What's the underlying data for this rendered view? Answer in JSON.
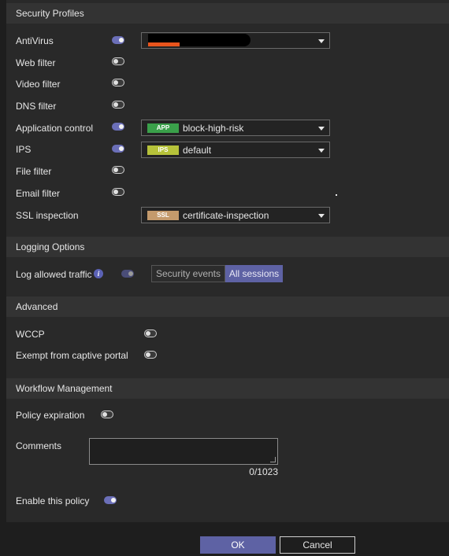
{
  "security_profiles": {
    "header": "Security Profiles",
    "rows": [
      {
        "label": "AntiVirus",
        "enabled": true,
        "badge": "",
        "value": "",
        "redacted": true
      },
      {
        "label": "Web filter",
        "enabled": false
      },
      {
        "label": "Video filter",
        "enabled": false
      },
      {
        "label": "DNS filter",
        "enabled": false
      },
      {
        "label": "Application control",
        "enabled": true,
        "badge": "APP",
        "badge_color": "#3aa04a",
        "value": "block-high-risk"
      },
      {
        "label": "IPS",
        "enabled": true,
        "badge": "IPS",
        "badge_color": "#b6c23a",
        "value": "default"
      },
      {
        "label": "File filter",
        "enabled": false
      },
      {
        "label": "Email filter",
        "enabled": false
      },
      {
        "label": "SSL inspection",
        "badge": "SSL",
        "badge_color": "#c49a6c",
        "value": "certificate-inspection"
      }
    ]
  },
  "logging": {
    "header": "Logging Options",
    "label": "Log allowed traffic",
    "info_icon": "info-icon",
    "options": [
      "Security events",
      "All sessions"
    ],
    "selected": "All sessions"
  },
  "advanced": {
    "header": "Advanced",
    "rows": [
      {
        "label": "WCCP",
        "enabled": false
      },
      {
        "label": "Exempt from captive portal",
        "enabled": false
      }
    ]
  },
  "workflow": {
    "header": "Workflow Management",
    "policy_expiration_label": "Policy expiration",
    "comments_label": "Comments",
    "comments_value": "",
    "comments_counter": "0/1023",
    "enable_label": "Enable this policy",
    "enable_value": true
  },
  "buttons": {
    "ok": "OK",
    "cancel": "Cancel"
  },
  "colors": {
    "accent": "#5e62a4",
    "toggle_on": "#6b6fb8",
    "redaction": "#e8541c"
  }
}
